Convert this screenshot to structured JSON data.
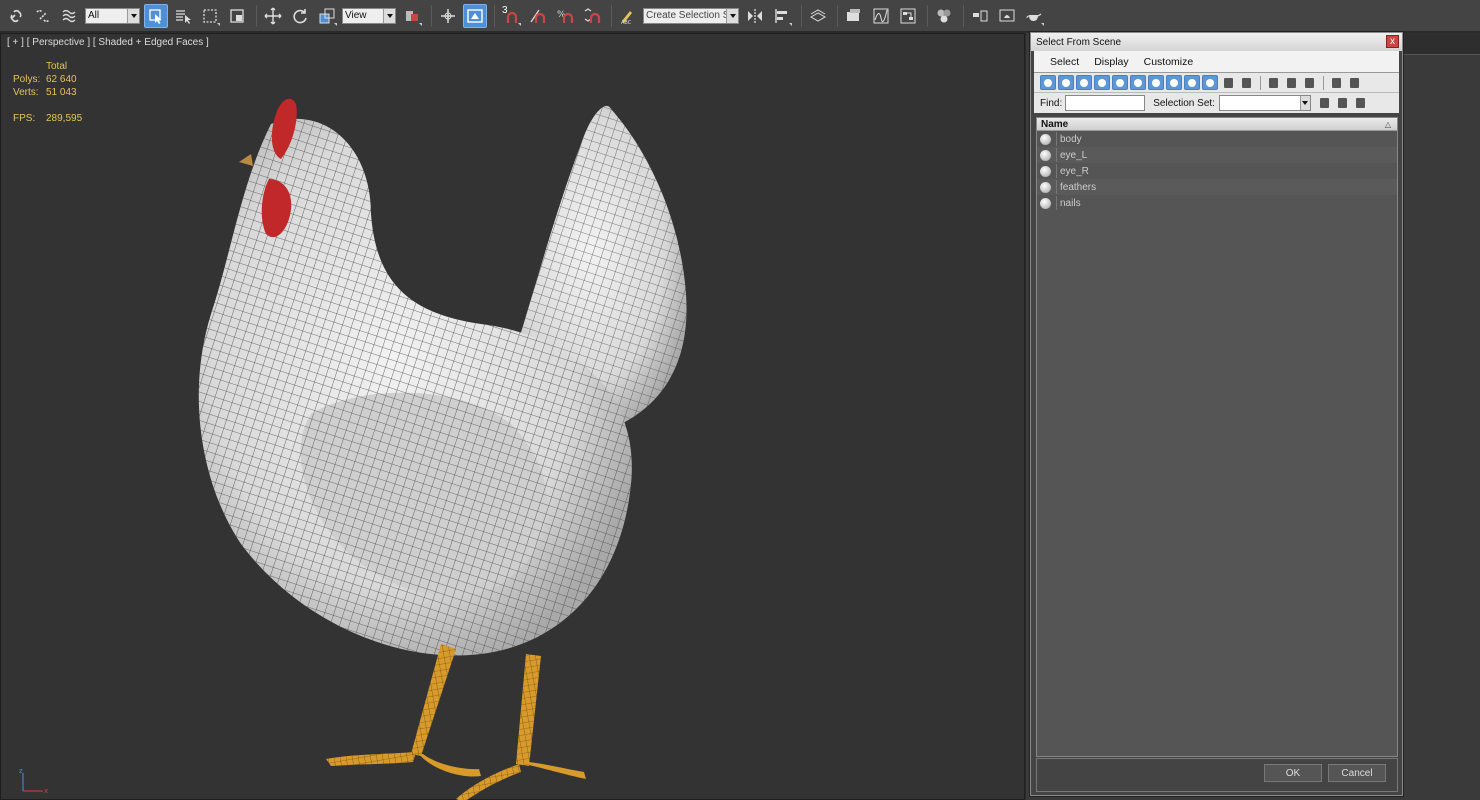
{
  "toolbar": {
    "filter_value": "All",
    "refcoord_value": "View",
    "snap_num": "3",
    "named_selection_placeholder": "Create Selection Se",
    "icons": [
      "link-icon",
      "unlink-icon",
      "bind-spacewarp-icon",
      "select-object-icon",
      "select-by-name-icon",
      "rect-region-icon",
      "window-crossing-icon",
      "move-icon",
      "rotate-icon",
      "scale-icon",
      "pivot-icon",
      "select-manipulate-icon",
      "snaps-toggle-icon",
      "angle-snap-icon",
      "percent-snap-icon",
      "spinner-snap-icon",
      "edit-named-sel-icon",
      "mirror-icon",
      "align-icon",
      "layer-manager-icon",
      "scene-explorer-icon",
      "curve-editor-icon",
      "schematic-view-icon",
      "material-editor-icon",
      "render-setup-icon",
      "rendered-frame-icon",
      "render-teapot-icon"
    ]
  },
  "viewport": {
    "label": "[ + ] [ Perspective ] [ Shaded + Edged Faces ]",
    "stats": {
      "total_label": "Total",
      "polys_label": "Polys:",
      "polys_value": "62 640",
      "verts_label": "Verts:",
      "verts_value": "51 043",
      "fps_label": "FPS:",
      "fps_value": "289,595"
    },
    "axis": {
      "x_label": "x",
      "z_label": "z"
    }
  },
  "dialog": {
    "title": "Select From Scene",
    "close_label": "x",
    "menu": [
      "Select",
      "Display",
      "Customize"
    ],
    "find_label": "Find:",
    "find_value": "",
    "selection_set_label": "Selection Set:",
    "selection_set_value": "",
    "list_header": "Name",
    "objects": [
      "body",
      "eye_L",
      "eye_R",
      "feathers",
      "nails"
    ],
    "ok_label": "OK",
    "cancel_label": "Cancel"
  },
  "colors": {
    "accent": "#4f8fd6",
    "stats_text": "#e6c35a",
    "viewport_bg": "#333333",
    "chicken_feet": "#d89a2a",
    "comb_red": "#c0282a"
  }
}
